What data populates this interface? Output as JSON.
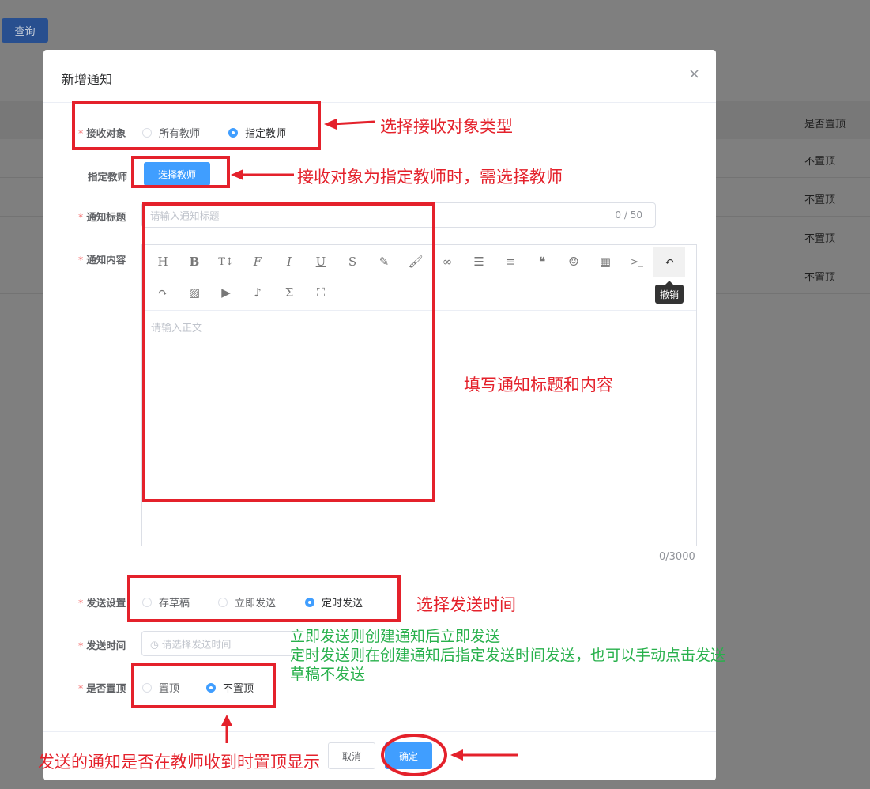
{
  "background": {
    "query_button": "查询",
    "column_header": "是否置顶",
    "rows": [
      "不置顶",
      "不置顶",
      "不置顶",
      "不置顶"
    ]
  },
  "modal": {
    "title": "新增通知",
    "close_icon": "×",
    "fields": {
      "recipient": {
        "label": "接收对象",
        "options": [
          "所有教师",
          "指定教师"
        ],
        "selected": "指定教师"
      },
      "teacher": {
        "label": "指定教师",
        "button": "选择教师"
      },
      "title": {
        "label": "通知标题",
        "placeholder": "请输入通知标题",
        "counter": "0 / 50"
      },
      "content": {
        "label": "通知内容",
        "placeholder": "请输入正文",
        "counter": "0/3000",
        "tooltip": "撤销",
        "toolbar_row1": [
          "heading-icon",
          "bold-icon",
          "font-size-icon",
          "font-family-icon",
          "italic-icon",
          "underline-icon",
          "strikethrough-icon",
          "font-color-icon",
          "background-color-icon",
          "link-icon",
          "list-icon",
          "justify-icon",
          "quote-icon",
          "emoji-icon",
          "table-icon",
          "code-icon",
          "undo-icon"
        ],
        "toolbar_row2": [
          "redo-icon",
          "image-icon",
          "video-icon",
          "audio-icon",
          "formula-icon",
          "fullscreen-icon"
        ]
      },
      "send_setting": {
        "label": "发送设置",
        "options": [
          "存草稿",
          "立即发送",
          "定时发送"
        ],
        "selected": "定时发送"
      },
      "send_time": {
        "label": "发送时间",
        "placeholder": "请选择发送时间"
      },
      "pin": {
        "label": "是否置顶",
        "options": [
          "置顶",
          "不置顶"
        ],
        "selected": "不置顶"
      }
    },
    "footer": {
      "cancel": "取消",
      "confirm": "确定"
    }
  },
  "annotations": {
    "recipient": "选择接收对象类型",
    "teacher": "接收对象为指定教师时，需选择教师",
    "content": "填写通知标题和内容",
    "send_time": "选择发送时间",
    "send_explain": [
      "立即发送则创建通知后立即发送",
      "定时发送则在创建通知后指定发送时间发送，也可以手动点击发送",
      "草稿不发送"
    ],
    "pin": "发送的通知是否在教师收到时置顶显示"
  },
  "colors": {
    "primary": "#409eff",
    "annotation_red": "#e4212b",
    "annotation_green": "#27b04b",
    "overlay": "#7f7f7f"
  }
}
